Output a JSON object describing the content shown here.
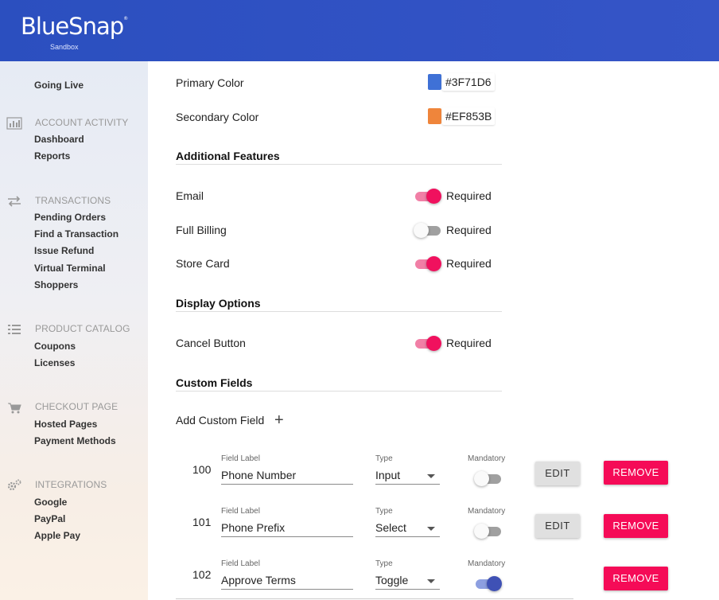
{
  "header": {
    "logo": "BlueSnap",
    "logo_mark": "®",
    "env": "Sandbox"
  },
  "sidebar": {
    "going_live": "Going Live",
    "account_activity": {
      "title": "ACCOUNT ACTIVITY",
      "icon": "bar-chart-icon",
      "items": [
        "Dashboard",
        "Reports"
      ]
    },
    "transactions": {
      "title": "TRANSACTIONS",
      "icon": "arrows-icon",
      "items": [
        "Pending Orders",
        "Find a Transaction",
        "Issue Refund",
        "Virtual Terminal",
        "Shoppers"
      ]
    },
    "product_catalog": {
      "title": "PRODUCT CATALOG",
      "icon": "list-icon",
      "items": [
        "Coupons",
        "Licenses"
      ]
    },
    "checkout_page": {
      "title": "CHECKOUT PAGE",
      "icon": "cart-icon",
      "items": [
        "Hosted Pages",
        "Payment Methods"
      ]
    },
    "integrations": {
      "title": "INTEGRATIONS",
      "icon": "gears-icon",
      "items": [
        "Google",
        "PayPal",
        "Apple Pay"
      ]
    }
  },
  "colors": {
    "primary": {
      "label": "Primary Color",
      "value": "#3F71D6"
    },
    "secondary": {
      "label": "Secondary Color",
      "value": "#EF853B"
    }
  },
  "additional_features": {
    "title": "Additional Features",
    "items": [
      {
        "label": "Email",
        "required_label": "Required",
        "on": true
      },
      {
        "label": "Full Billing",
        "required_label": "Required",
        "on": false
      },
      {
        "label": "Store Card",
        "required_label": "Required",
        "on": true
      }
    ]
  },
  "display_options": {
    "title": "Display Options",
    "items": [
      {
        "label": "Cancel Button",
        "required_label": "Required",
        "on": true
      }
    ]
  },
  "custom_fields": {
    "title": "Custom Fields",
    "add_label": "Add Custom Field",
    "field_label_caption": "Field Label",
    "type_caption": "Type",
    "mandatory_caption": "Mandatory",
    "edit_label": "EDIT",
    "remove_label": "REMOVE",
    "rows": [
      {
        "id": "100",
        "field_label": "Phone Number",
        "type": "Input",
        "mandatory": false
      },
      {
        "id": "101",
        "field_label": "Phone Prefix",
        "type": "Select",
        "mandatory": false
      },
      {
        "id": "102",
        "field_label": "Approve Terms",
        "type": "Toggle",
        "mandatory": true
      }
    ]
  },
  "accent_colors": {
    "header": "#3152c4",
    "toggle_on": "#f0115e",
    "remove_button": "#f50b57",
    "mandatory_on": "#3f51b5"
  }
}
